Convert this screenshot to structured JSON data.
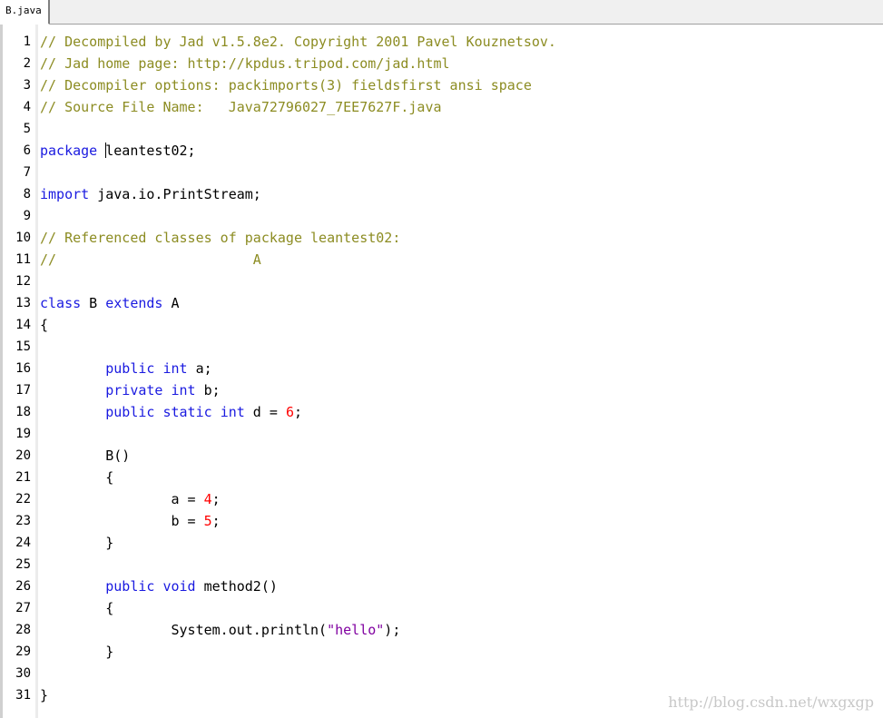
{
  "tab": {
    "label": "B.java"
  },
  "lines": [
    {
      "n": "1",
      "tokens": [
        {
          "t": "cm",
          "v": "// Decompiled by Jad v1.5.8e2. Copyright 2001 Pavel Kouznetsov."
        }
      ]
    },
    {
      "n": "2",
      "tokens": [
        {
          "t": "cm",
          "v": "// Jad home page: http://kpdus.tripod.com/jad.html"
        }
      ]
    },
    {
      "n": "3",
      "tokens": [
        {
          "t": "cm",
          "v": "// Decompiler options: packimports(3) fieldsfirst ansi space"
        }
      ]
    },
    {
      "n": "4",
      "tokens": [
        {
          "t": "cm",
          "v": "// Source File Name:   Java72796027_7EE7627F.java"
        }
      ]
    },
    {
      "n": "5",
      "tokens": []
    },
    {
      "n": "6",
      "tokens": [
        {
          "t": "kw",
          "v": "package"
        },
        {
          "t": "pl",
          "v": " "
        },
        {
          "t": "caret",
          "v": ""
        },
        {
          "t": "pl",
          "v": "leantest02;"
        }
      ]
    },
    {
      "n": "7",
      "tokens": []
    },
    {
      "n": "8",
      "tokens": [
        {
          "t": "kw",
          "v": "import"
        },
        {
          "t": "pl",
          "v": " java.io.PrintStream;"
        }
      ]
    },
    {
      "n": "9",
      "tokens": []
    },
    {
      "n": "10",
      "tokens": [
        {
          "t": "cm",
          "v": "// Referenced classes of package leantest02:"
        }
      ]
    },
    {
      "n": "11",
      "tokens": [
        {
          "t": "cm",
          "v": "//                        A"
        }
      ]
    },
    {
      "n": "12",
      "tokens": []
    },
    {
      "n": "13",
      "tokens": [
        {
          "t": "kw",
          "v": "class"
        },
        {
          "t": "pl",
          "v": " B "
        },
        {
          "t": "kw",
          "v": "extends"
        },
        {
          "t": "pl",
          "v": " A"
        }
      ]
    },
    {
      "n": "14",
      "tokens": [
        {
          "t": "pl",
          "v": "{"
        }
      ]
    },
    {
      "n": "15",
      "tokens": []
    },
    {
      "n": "16",
      "tokens": [
        {
          "t": "pl",
          "v": "        "
        },
        {
          "t": "kw",
          "v": "public"
        },
        {
          "t": "pl",
          "v": " "
        },
        {
          "t": "kw",
          "v": "int"
        },
        {
          "t": "pl",
          "v": " a;"
        }
      ]
    },
    {
      "n": "17",
      "tokens": [
        {
          "t": "pl",
          "v": "        "
        },
        {
          "t": "kw",
          "v": "private"
        },
        {
          "t": "pl",
          "v": " "
        },
        {
          "t": "kw",
          "v": "int"
        },
        {
          "t": "pl",
          "v": " b;"
        }
      ]
    },
    {
      "n": "18",
      "tokens": [
        {
          "t": "pl",
          "v": "        "
        },
        {
          "t": "kw",
          "v": "public"
        },
        {
          "t": "pl",
          "v": " "
        },
        {
          "t": "kw",
          "v": "static"
        },
        {
          "t": "pl",
          "v": " "
        },
        {
          "t": "kw",
          "v": "int"
        },
        {
          "t": "pl",
          "v": " d = "
        },
        {
          "t": "num",
          "v": "6"
        },
        {
          "t": "pl",
          "v": ";"
        }
      ]
    },
    {
      "n": "19",
      "tokens": []
    },
    {
      "n": "20",
      "tokens": [
        {
          "t": "pl",
          "v": "        B()"
        }
      ]
    },
    {
      "n": "21",
      "tokens": [
        {
          "t": "pl",
          "v": "        {"
        }
      ]
    },
    {
      "n": "22",
      "tokens": [
        {
          "t": "pl",
          "v": "                a = "
        },
        {
          "t": "num",
          "v": "4"
        },
        {
          "t": "pl",
          "v": ";"
        }
      ]
    },
    {
      "n": "23",
      "tokens": [
        {
          "t": "pl",
          "v": "                b = "
        },
        {
          "t": "num",
          "v": "5"
        },
        {
          "t": "pl",
          "v": ";"
        }
      ]
    },
    {
      "n": "24",
      "tokens": [
        {
          "t": "pl",
          "v": "        }"
        }
      ]
    },
    {
      "n": "25",
      "tokens": []
    },
    {
      "n": "26",
      "tokens": [
        {
          "t": "pl",
          "v": "        "
        },
        {
          "t": "kw",
          "v": "public"
        },
        {
          "t": "pl",
          "v": " "
        },
        {
          "t": "kw",
          "v": "void"
        },
        {
          "t": "pl",
          "v": " method2()"
        }
      ]
    },
    {
      "n": "27",
      "tokens": [
        {
          "t": "pl",
          "v": "        {"
        }
      ]
    },
    {
      "n": "28",
      "tokens": [
        {
          "t": "pl",
          "v": "                System.out.println("
        },
        {
          "t": "str",
          "v": "\"hello\""
        },
        {
          "t": "pl",
          "v": ");"
        }
      ]
    },
    {
      "n": "29",
      "tokens": [
        {
          "t": "pl",
          "v": "        }"
        }
      ]
    },
    {
      "n": "30",
      "tokens": []
    },
    {
      "n": "31",
      "tokens": [
        {
          "t": "pl",
          "v": "}"
        }
      ]
    }
  ],
  "watermark": "http://blog.csdn.net/wxgxgp",
  "colors": {
    "comment": "#8c8c22",
    "keyword": "#1a1ae0",
    "number": "#ff0000",
    "string": "#8000a0"
  }
}
